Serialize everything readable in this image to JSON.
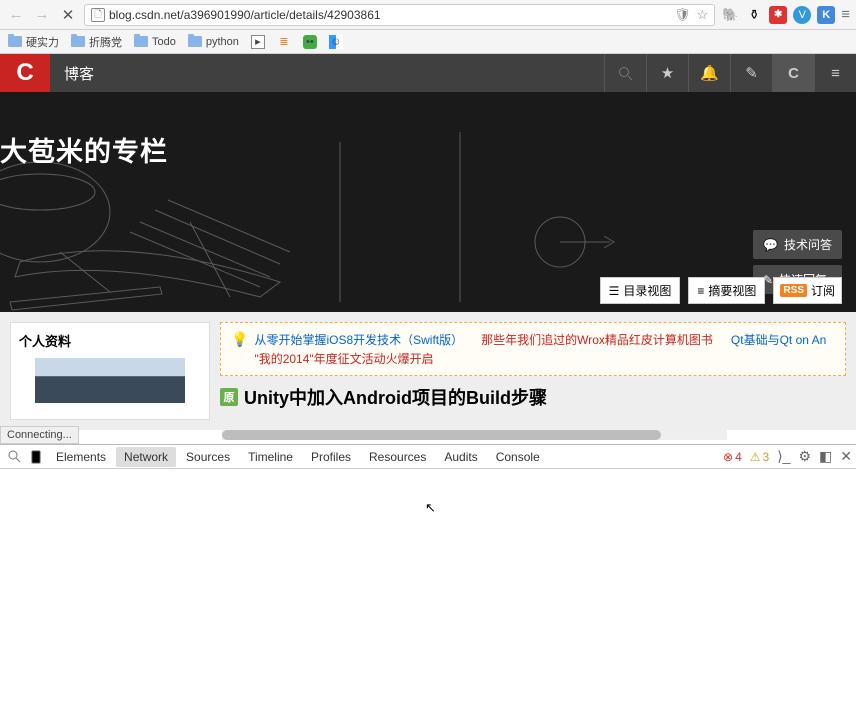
{
  "browser": {
    "url": "blog.csdn.net/a396901990/article/details/42903861",
    "status": "Connecting..."
  },
  "bookmarks": [
    "硬实力",
    "折腾党",
    "Todo",
    "python"
  ],
  "csdn": {
    "logo": "C",
    "blog": "博客"
  },
  "hero": {
    "title": "大苞米的专栏",
    "tech_qa": "技术问答",
    "quick_reply": "快速回复",
    "list_view": "目录视图",
    "summary_view": "摘要视图",
    "rss": "RSS",
    "subscribe": "订阅"
  },
  "sidebar": {
    "profile_title": "个人资料"
  },
  "notices": [
    "从零开始掌握iOS8开发技术（Swift版）",
    "那些年我们追过的Wrox精品红皮计算机图书",
    "Qt基础与Qt on An",
    "\"我的2014\"年度征文活动火爆开启"
  ],
  "article": {
    "badge": "原",
    "title": "Unity中加入Android项目的Build步骤"
  },
  "devtools": {
    "tabs": [
      "Elements",
      "Network",
      "Sources",
      "Timeline",
      "Profiles",
      "Resources",
      "Audits",
      "Console"
    ],
    "active_tab": 1,
    "errors": "4",
    "warnings": "3"
  },
  "hscroll": {
    "thumb_width_pct": 87
  }
}
